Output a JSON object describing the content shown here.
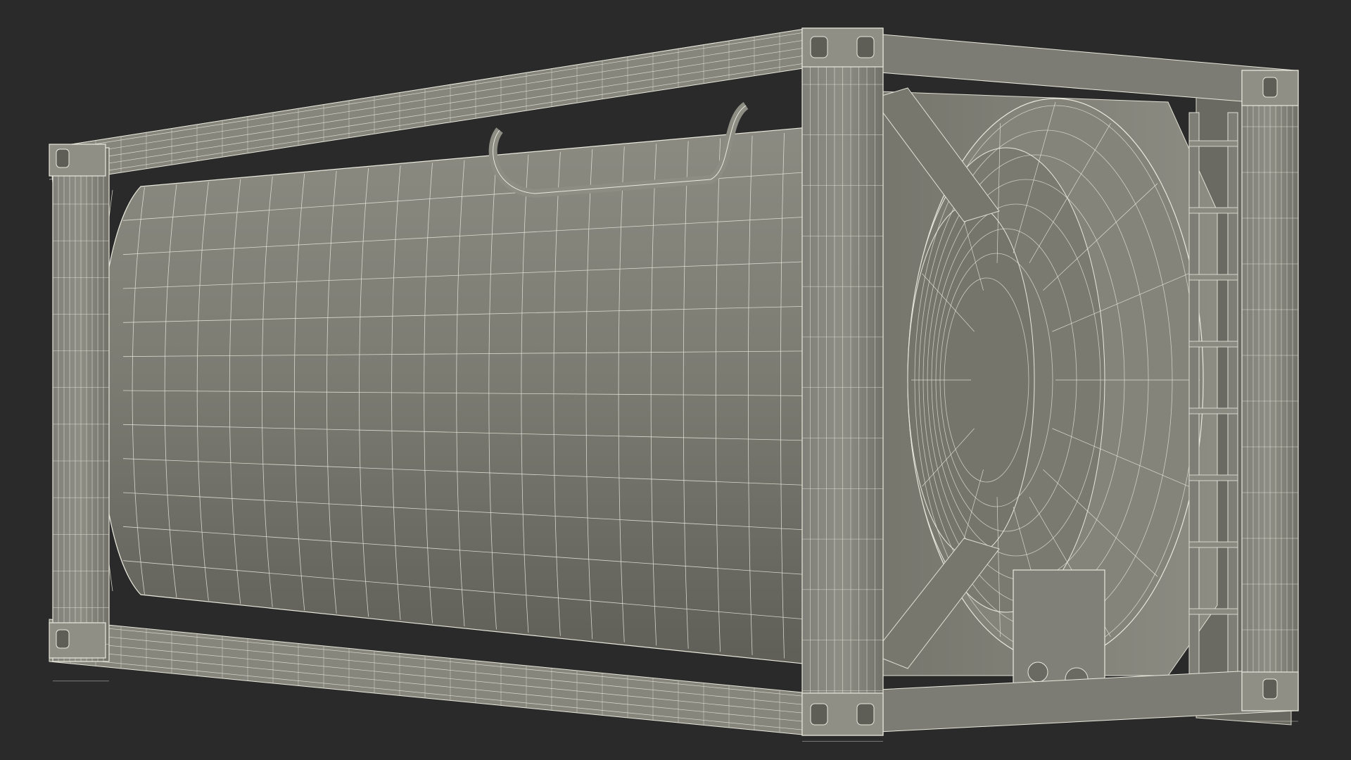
{
  "scene": {
    "subject": "tank-container-wireframe",
    "colors": {
      "background": "#2a2a2a",
      "shell": "#7d7d74",
      "shell_dark": "#66665e",
      "frame": "#8a8a80",
      "frame_dark": "#6f6f66",
      "wire": "#e8e8dc",
      "shadow": "#55554e"
    }
  }
}
